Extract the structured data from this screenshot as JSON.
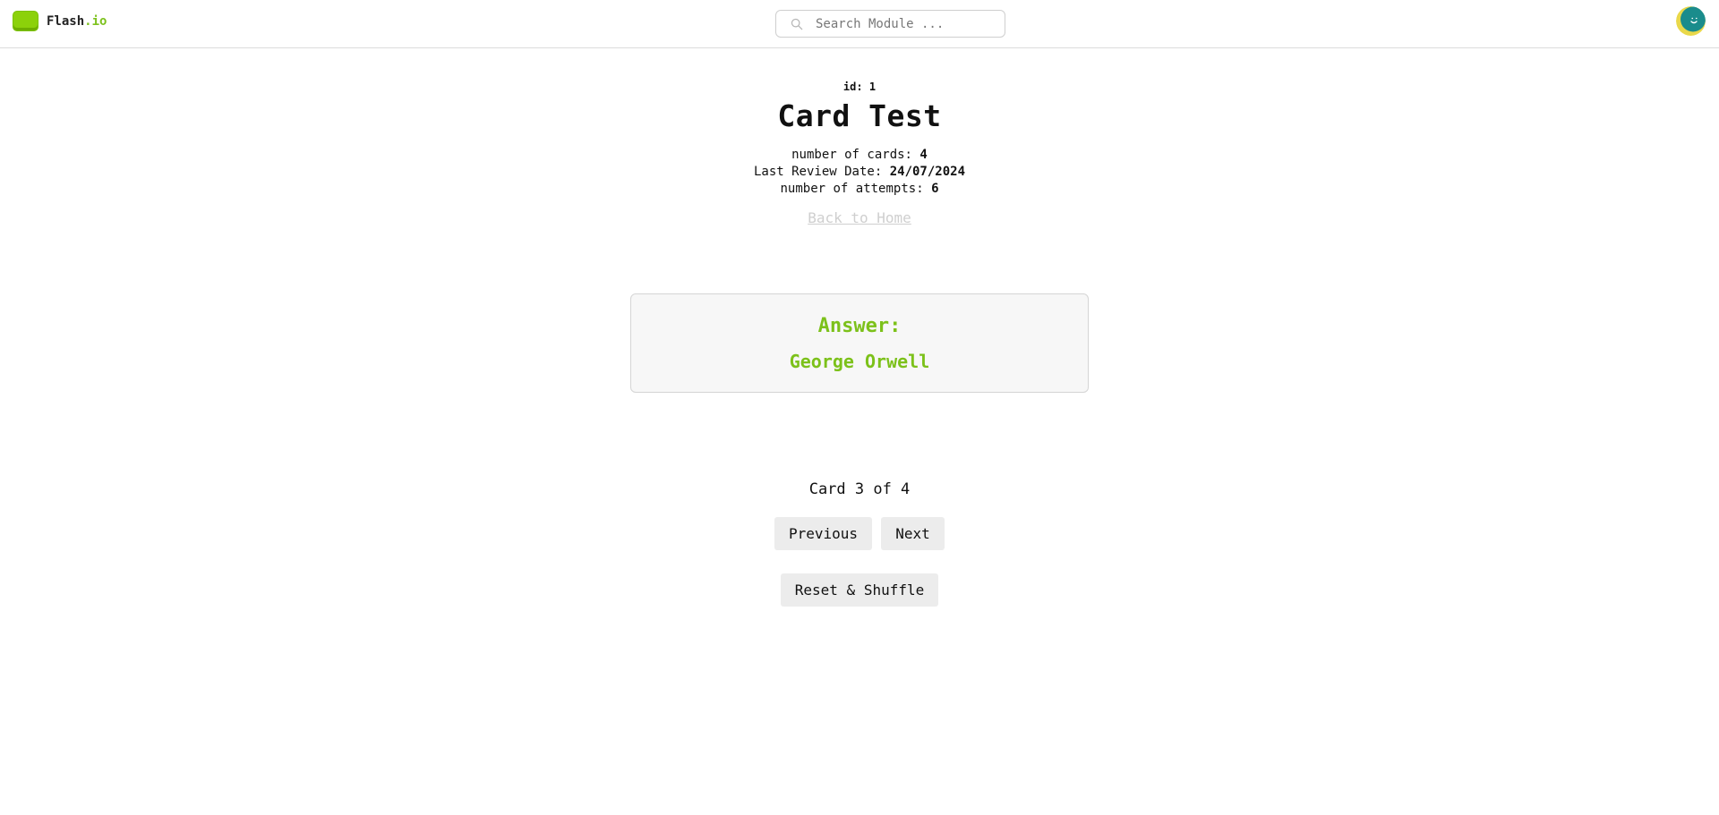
{
  "nav": {
    "brand_main": "Flash",
    "brand_accent": ".io",
    "search_placeholder": "Search Module ...",
    "accent_color": "#8cd10a"
  },
  "module": {
    "id_label": "id:",
    "id_value": "1",
    "title": "Card Test",
    "cards_label": "number of cards:",
    "cards_value": "4",
    "review_label": "Last Review Date:",
    "review_value": "24/07/2024",
    "attempts_label": "number of attempts:",
    "attempts_value": "6",
    "back_link": "Back to Home"
  },
  "card": {
    "label": "Answer:",
    "answer": "George Orwell",
    "text_color": "#7cc11a"
  },
  "pager": {
    "counter": "Card 3 of 4",
    "previous_label": "Previous",
    "next_label": "Next",
    "reset_label": "Reset & Shuffle"
  },
  "icons": {
    "search": "search-icon",
    "avatar": "user-avatar"
  }
}
